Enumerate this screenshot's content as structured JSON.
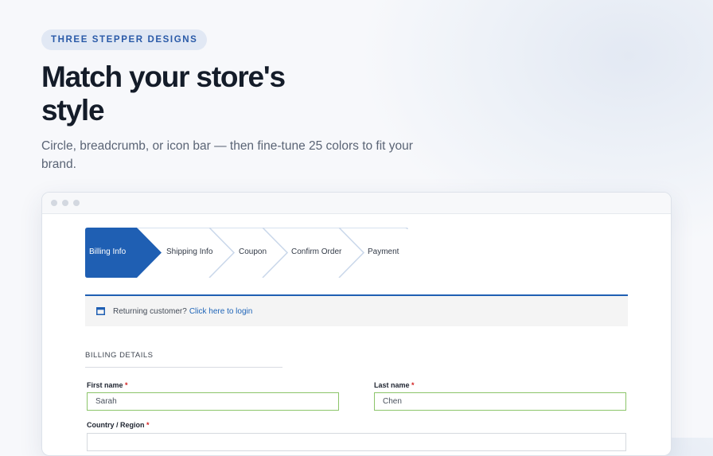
{
  "hero": {
    "badge": "THREE STEPPER DESIGNS",
    "title": "Match your store's style",
    "subtitle": "Circle, breadcrumb, or icon bar — then fine-tune 25 colors to fit your brand."
  },
  "stepper": {
    "steps": [
      "Billing Info",
      "Shipping Info",
      "Coupon",
      "Confirm Order",
      "Payment"
    ],
    "active_index": 0
  },
  "notice": {
    "text": "Returning customer?",
    "link": "Click here to login"
  },
  "billing": {
    "section_title": "BILLING DETAILS",
    "required_mark": "*",
    "first_name": {
      "label": "First name",
      "value": "Sarah"
    },
    "last_name": {
      "label": "Last name",
      "value": "Chen"
    },
    "country": {
      "label": "Country / Region",
      "value": ""
    }
  },
  "colors": {
    "accent": "#1f5fb3",
    "valid_border": "#8cc56a",
    "required": "#d21f1f"
  }
}
